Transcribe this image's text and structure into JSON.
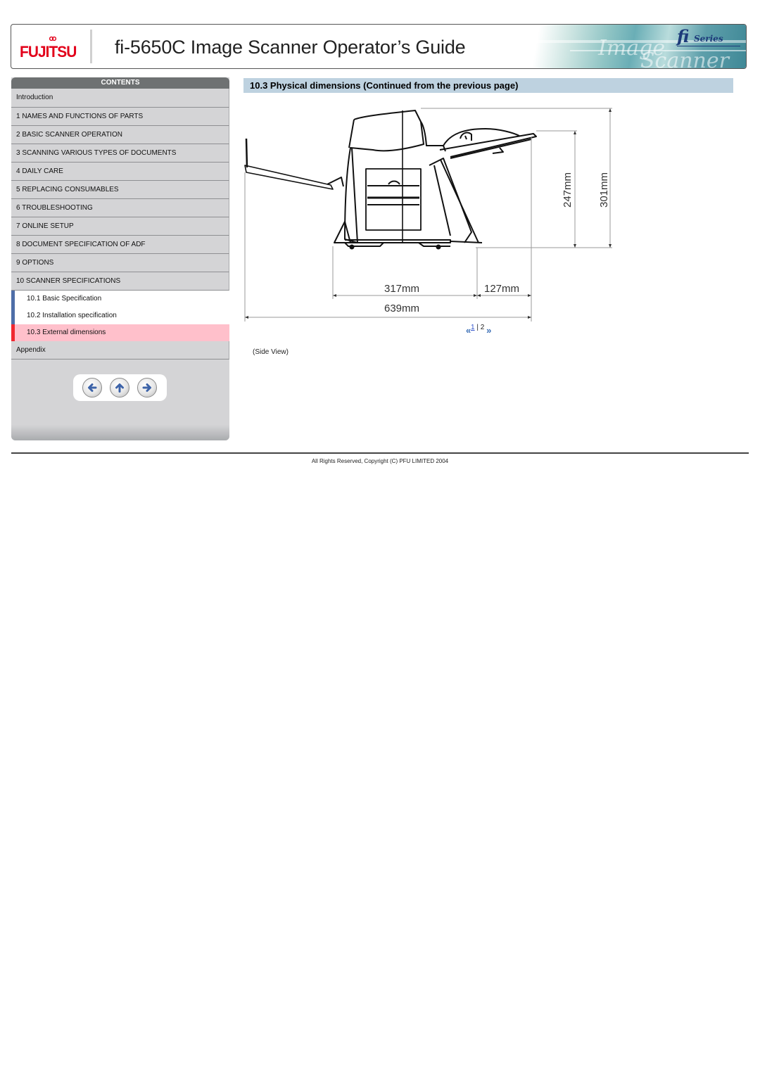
{
  "header": {
    "logo_text": "FUJITSU",
    "title": "fi-5650C Image Scanner Operator’s Guide",
    "series_logo": {
      "fi": "fi",
      "series": "Series"
    },
    "brand_color": "#e2001a"
  },
  "sidebar": {
    "contents_label": "CONTENTS",
    "items": [
      {
        "label": "Introduction"
      },
      {
        "label": "1 NAMES AND FUNCTIONS OF PARTS"
      },
      {
        "label": "2 BASIC SCANNER OPERATION"
      },
      {
        "label": "3 SCANNING VARIOUS TYPES OF DOCUMENTS"
      },
      {
        "label": "4 DAILY CARE"
      },
      {
        "label": "5 REPLACING CONSUMABLES"
      },
      {
        "label": "6 TROUBLESHOOTING"
      },
      {
        "label": "7 ONLINE SETUP"
      },
      {
        "label": "8 DOCUMENT SPECIFICATION OF ADF"
      },
      {
        "label": "9 OPTIONS"
      },
      {
        "label": "10 SCANNER SPECIFICATIONS"
      }
    ],
    "sub_items": [
      {
        "label": "10.1 Basic Specification",
        "active": false
      },
      {
        "label": "10.2 Installation specification",
        "active": false
      },
      {
        "label": "10.3 External dimensions",
        "active": true
      }
    ],
    "appendix_label": "Appendix",
    "nav_buttons": [
      {
        "name": "previous-page",
        "icon": "arrow-left-icon"
      },
      {
        "name": "top-of-page",
        "icon": "arrow-up-icon"
      },
      {
        "name": "next-page",
        "icon": "arrow-right-icon"
      }
    ],
    "colors": {
      "sub_marker": "#4e6ea8",
      "active_marker": "#f02830",
      "active_bg": "#ffc0cb"
    }
  },
  "main": {
    "section_title": "10.3 Physical dimensions (Continued from the previous page)",
    "drawing": {
      "view": "side",
      "dimensions": {
        "height_body": "247mm",
        "height_total": "301mm",
        "depth_base": "317mm",
        "depth_stacker": "127mm",
        "depth_total": "639mm"
      }
    },
    "pager": {
      "prev_icon": "double-chevron-left-icon",
      "next_icon": "double-chevron-right-icon",
      "pages": [
        "1",
        "2"
      ],
      "current_page": "2",
      "separator": "|"
    },
    "caption": "(Side View)"
  },
  "footer": {
    "copyright": "All Rights Reserved, Copyright (C) PFU LIMITED 2004"
  }
}
